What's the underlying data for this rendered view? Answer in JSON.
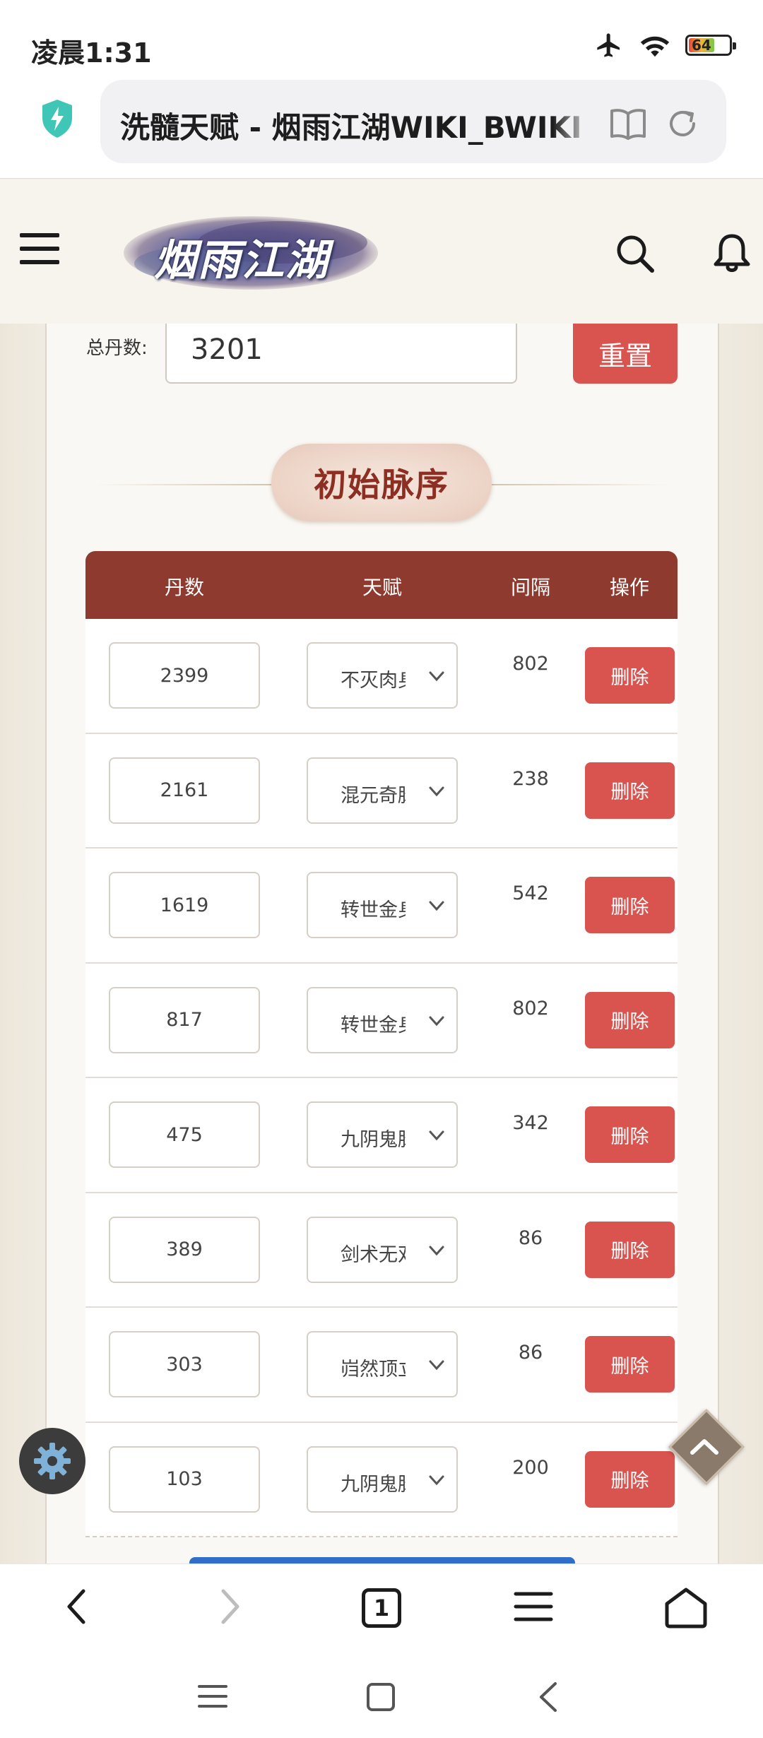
{
  "status": {
    "time": "凌晨1:31",
    "battery": "64"
  },
  "browser": {
    "url_title": "洗髓天赋 - 烟雨江湖WIKI_BWIKI",
    "tab_count": "1"
  },
  "site": {
    "logo_text": "烟雨江湖"
  },
  "form": {
    "total_label": "总丹数:",
    "total_value": "3201",
    "reset_label": "重置"
  },
  "section": {
    "title": "初始脉序"
  },
  "table": {
    "headers": [
      "丹数",
      "天赋",
      "间隔",
      "操作"
    ],
    "rows": [
      {
        "dan": "2399",
        "talent": "不灭肉身",
        "gap": "802",
        "action": "删除"
      },
      {
        "dan": "2161",
        "talent": "混元奇脉",
        "gap": "238",
        "action": "删除"
      },
      {
        "dan": "1619",
        "talent": "转世金身",
        "gap": "542",
        "action": "删除"
      },
      {
        "dan": "817",
        "talent": "转世金身",
        "gap": "802",
        "action": "删除"
      },
      {
        "dan": "475",
        "talent": "九阴鬼脉",
        "gap": "342",
        "action": "删除"
      },
      {
        "dan": "389",
        "talent": "剑术无双",
        "gap": "86",
        "action": "删除"
      },
      {
        "dan": "303",
        "talent": "岿然顶立",
        "gap": "86",
        "action": "删除"
      },
      {
        "dan": "103",
        "talent": "九阴鬼脉",
        "gap": "200",
        "action": "删除"
      }
    ]
  },
  "colors": {
    "accent_red": "#d9534f",
    "header_brown": "#8f3a2e",
    "title_red": "#8c2f22"
  }
}
